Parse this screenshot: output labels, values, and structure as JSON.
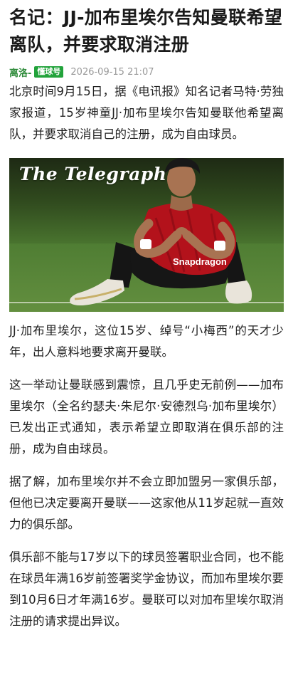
{
  "article": {
    "title": "名记：JJ-加布里埃尔告知曼联希望离队，并要求取消注册",
    "author": "离洛-",
    "source_badge": "懂球号",
    "timestamp": "2026-09-15 21:07",
    "lead": "北京时间9月15日，据《电讯报》知名记者马特·劳独家报道，15岁神童JJ·加布里埃尔告知曼联他希望离队，并要求取消自己的注册，成为自由球员。",
    "image": {
      "watermark": "The Telegraph",
      "shirt_sponsor": "Snapdragon"
    },
    "caption": "JJ·加布里埃尔，这位15岁、绰号“小梅西”的天才少年，出人意料地要求离开曼联。",
    "paragraphs": [
      "这一举动让曼联感到震惊，且几乎史无前例——加布里埃尔（全名约瑟夫·朱尼尔·安德烈乌·加布里埃尔）已发出正式通知，表示希望立即取消在俱乐部的注册，成为自由球员。",
      "据了解，加布里埃尔并不会立即加盟另一家俱乐部，但他已决定要离开曼联——这家他从11岁起就一直效力的俱乐部。",
      "俱乐部不能与17岁以下的球员签署职业合同，也不能在球员年满16岁前签署奖学金协议，而加布里埃尔要到10月6日才年满16岁。曼联可以对加布里埃尔取消注册的请求提出异议。"
    ]
  },
  "colors": {
    "author": "#2e8b3a",
    "badge": "#22a33b",
    "timestamp": "#999999",
    "text": "#222222"
  }
}
